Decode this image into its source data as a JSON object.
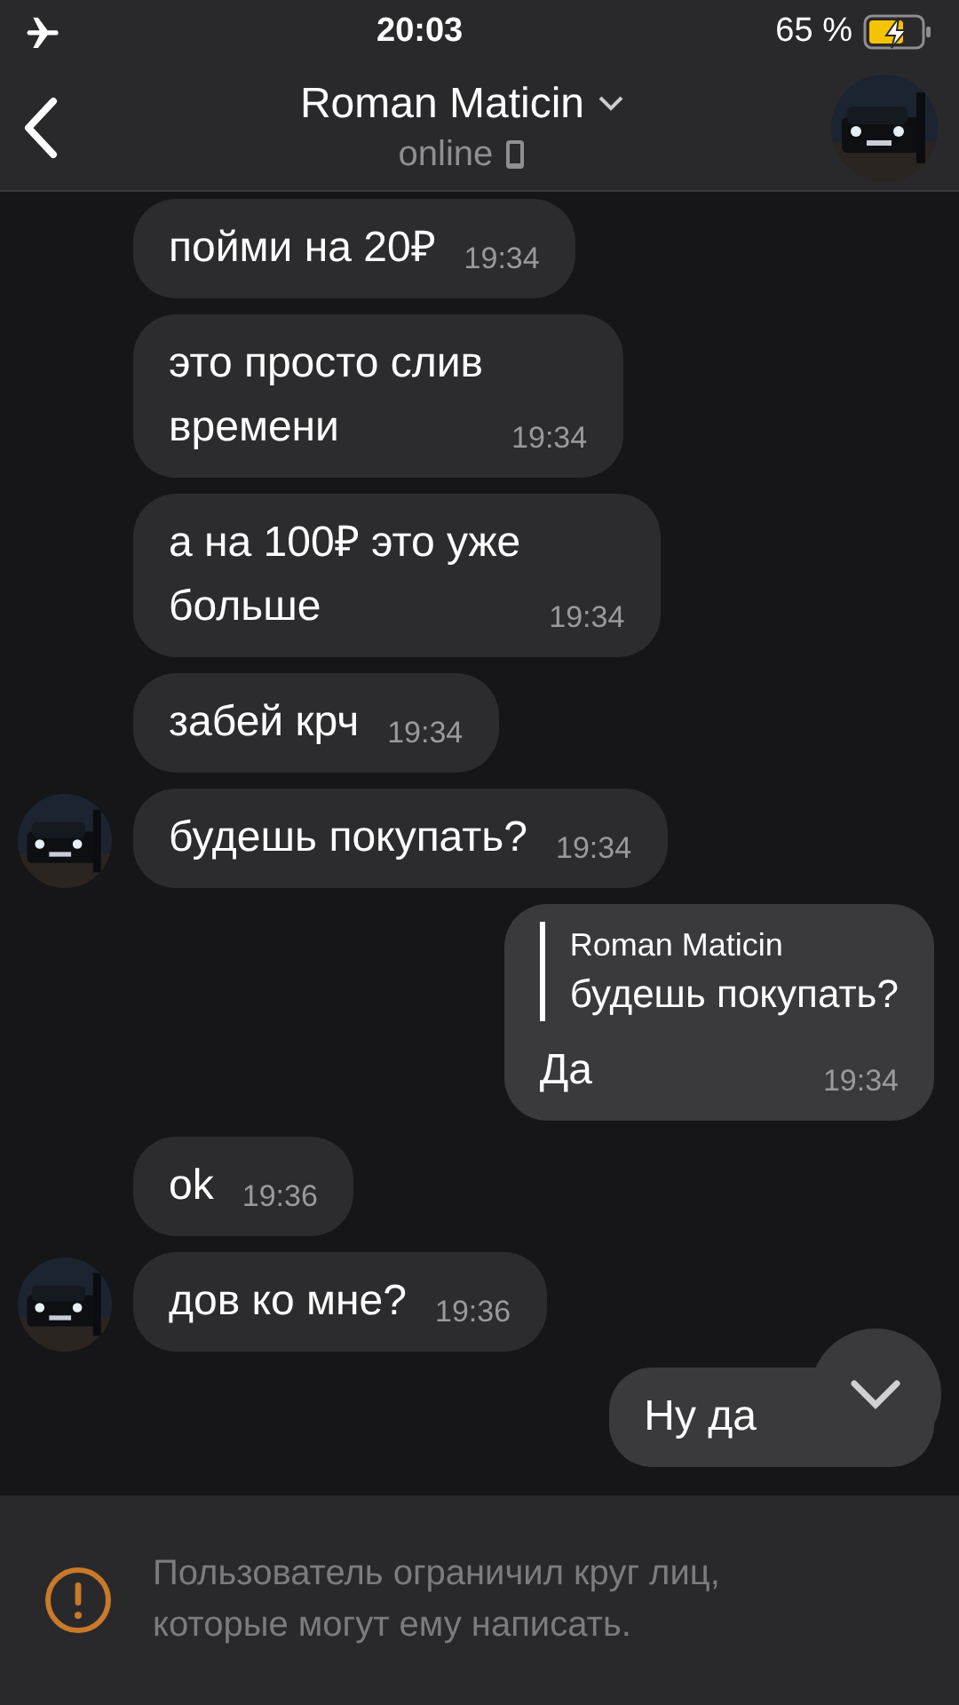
{
  "status_bar": {
    "time": "20:03",
    "battery": "65 %"
  },
  "header": {
    "name": "Roman Maticin",
    "status": "online"
  },
  "messages": [
    {
      "kind": "incoming",
      "text": "пойми на 20₽",
      "time": "19:34",
      "show_avatar": false
    },
    {
      "kind": "incoming",
      "text": "это просто слив\nвремени",
      "time": "19:34",
      "show_avatar": false
    },
    {
      "kind": "incoming",
      "text": "а на 100₽ это уже\nбольше",
      "time": "19:34",
      "show_avatar": false
    },
    {
      "kind": "incoming",
      "text": "забей крч",
      "time": "19:34",
      "show_avatar": false
    },
    {
      "kind": "incoming",
      "text": "будешь покупать?",
      "time": "19:34",
      "show_avatar": true
    },
    {
      "kind": "outgoing",
      "quote": {
        "author": "Roman Maticin",
        "text": "будешь покупать?"
      },
      "text": "Да",
      "time": "19:34"
    },
    {
      "kind": "incoming",
      "text": "ok",
      "time": "19:36",
      "show_avatar": false
    },
    {
      "kind": "incoming",
      "text": "дов ко мне?",
      "time": "19:36",
      "show_avatar": true
    },
    {
      "kind": "outgoing",
      "text": "Ну да"
    }
  ],
  "notice": {
    "text": "Пользователь ограничил круг лиц, которые могут ему написать."
  }
}
